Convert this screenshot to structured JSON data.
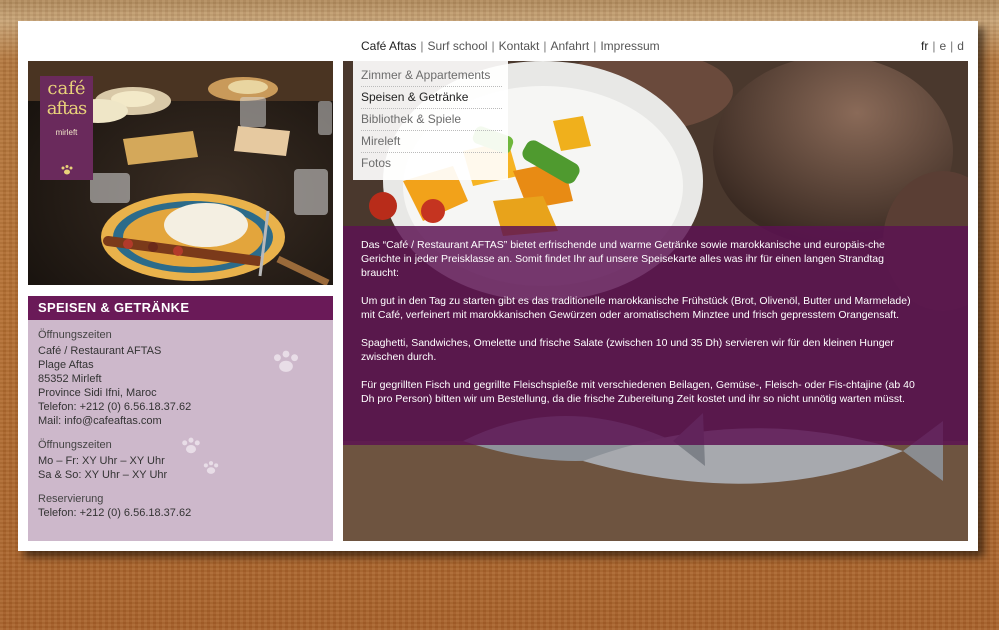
{
  "colors": {
    "accent": "#6a1a58",
    "info_bg": "#cdb8cb",
    "overlay": "#5c1252"
  },
  "nav": {
    "items": [
      {
        "label": "Café Aftas",
        "active": true
      },
      {
        "label": "Surf school",
        "active": false
      },
      {
        "label": "Kontakt",
        "active": false
      },
      {
        "label": "Anfahrt",
        "active": false
      },
      {
        "label": "Impressum",
        "active": false
      }
    ],
    "sep": "|"
  },
  "lang": {
    "items": [
      {
        "label": "fr",
        "active": true
      },
      {
        "label": "e",
        "active": false
      },
      {
        "label": "d",
        "active": false
      }
    ]
  },
  "logo": {
    "line1": "café",
    "line2": "aftas",
    "line3": "mirleft",
    "icon": "paw-icon"
  },
  "submenu": {
    "items": [
      {
        "label": "Zimmer & Appartements",
        "active": false
      },
      {
        "label": "Speisen & Getränke",
        "active": true
      },
      {
        "label": "Bibliothek & Spiele",
        "active": false
      },
      {
        "label": "Mireleft",
        "active": false
      },
      {
        "label": "Fotos",
        "active": false
      }
    ]
  },
  "info": {
    "title": "SPEISEN & GETRÄNKE",
    "block1": {
      "heading": "Öffnungszeiten",
      "lines": [
        "Café / Restaurant AFTAS",
        "Plage Aftas",
        "85352 Mirleft",
        "Province Sidi Ifni, Maroc",
        "Telefon: +212 (0) 6.56.18.37.62",
        "Mail: info@cafeaftas.com"
      ]
    },
    "block2": {
      "heading": "Öffnungszeiten",
      "lines": [
        "Mo – Fr: XY Uhr – XY Uhr",
        "Sa & So: XY Uhr – XY Uhr"
      ]
    },
    "block3": {
      "heading": "Reservierung",
      "lines": [
        "Telefon: +212 (0) 6.56.18.37.62"
      ]
    }
  },
  "content": {
    "paragraphs": [
      "Das “Café / Restaurant AFTAS” bietet erfrischende und warme Getränke sowie marokkanische und europäis-che Gerichte in jeder Preisklasse an. Somit findet Ihr auf unsere Speisekarte alles was ihr für einen langen Strandtag braucht:",
      "Um gut in den Tag zu starten gibt es das traditionelle marokkanische Frühstück (Brot, Olivenöl, Butter und Marmelade) mit Café, verfeinert mit marokkanischen Gewürzen oder aromatischem Minztee und frisch gepresstem Orangensaft.",
      "Spaghetti, Sandwiches, Omelette und frische Salate (zwischen 10 und 35 Dh) servieren wir für den kleinen Hunger zwischen durch.",
      "Für gegrillten Fisch und gegrillte Fleischspieße mit verschiedenen Beilagen, Gemüse-, Fleisch- oder Fis-chtajine (ab 40 Dh pro Person) bitten wir um Bestellung, da die frische Zubereitung Zeit kostet und ihr so nicht unnötig warten müsst."
    ]
  }
}
